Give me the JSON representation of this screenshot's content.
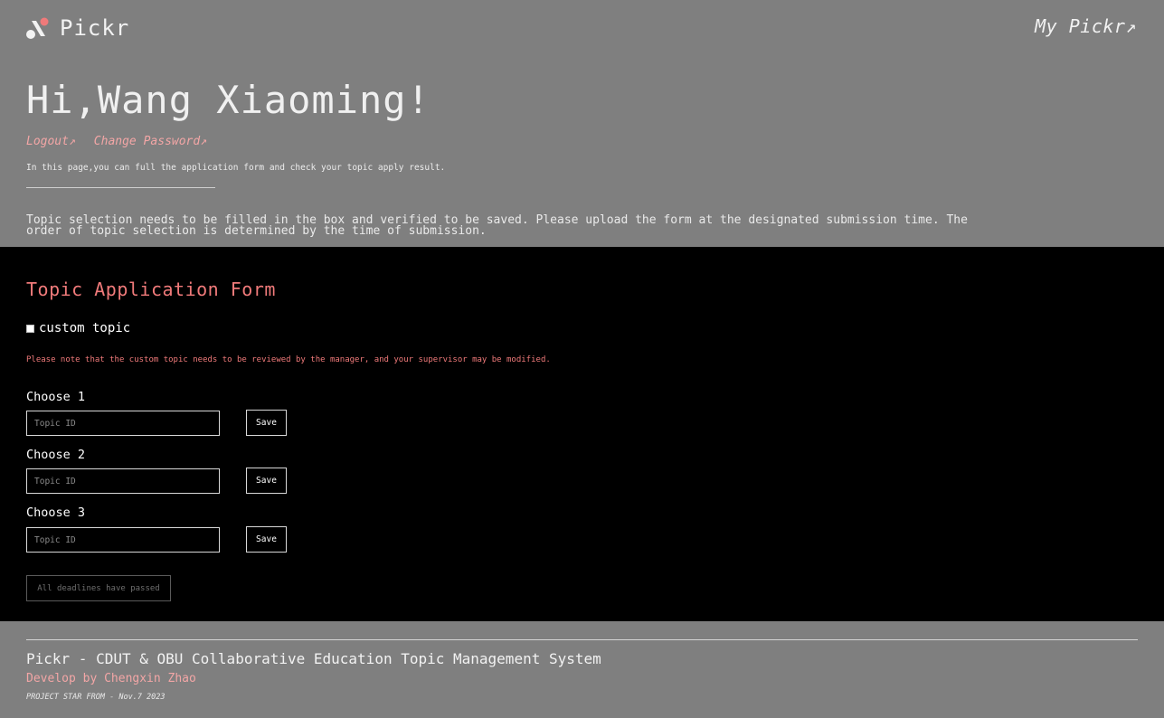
{
  "header": {
    "logo_text": "Pickr",
    "my_pickr_link": "My Pickr↗",
    "greeting": "Hi,Wang Xiaoming!",
    "logout_link": "Logout↗",
    "change_password_link": "Change Password↗",
    "hint": "In this page,you can full the application form and check your topic apply result.",
    "notice": "Topic selection needs to be filled in the box and verified to be saved. Please upload the form at the designated submission time. The order of topic selection is determined by the time of submission."
  },
  "form": {
    "title": "Topic Application Form",
    "custom_topic_label": "custom topic",
    "warning": "Please note that the custom topic needs to be reviewed by the manager, and your supervisor may be modified.",
    "choices": [
      {
        "label": "Choose 1",
        "placeholder": "Topic ID",
        "value": "",
        "button": "Save"
      },
      {
        "label": "Choose 2",
        "placeholder": "Topic ID",
        "value": "",
        "button": "Save"
      },
      {
        "label": "Choose 3",
        "placeholder": "Topic ID",
        "value": "",
        "button": "Save"
      }
    ],
    "deadline_button": "All deadlines have passed"
  },
  "footer": {
    "title": "Pickr - CDUT & OBU Collaborative Education Topic Management System",
    "developer": "Develop by Chengxin Zhao",
    "since": "PROJECT STAR FROM - Nov.7 2023"
  },
  "colors": {
    "background_gray": "#7f7f7f",
    "form_background": "#000000",
    "accent_pink": "#f07a7a",
    "link_pink": "#f3a6a6"
  },
  "icons": {
    "logo": "pickr-logo-icon"
  }
}
